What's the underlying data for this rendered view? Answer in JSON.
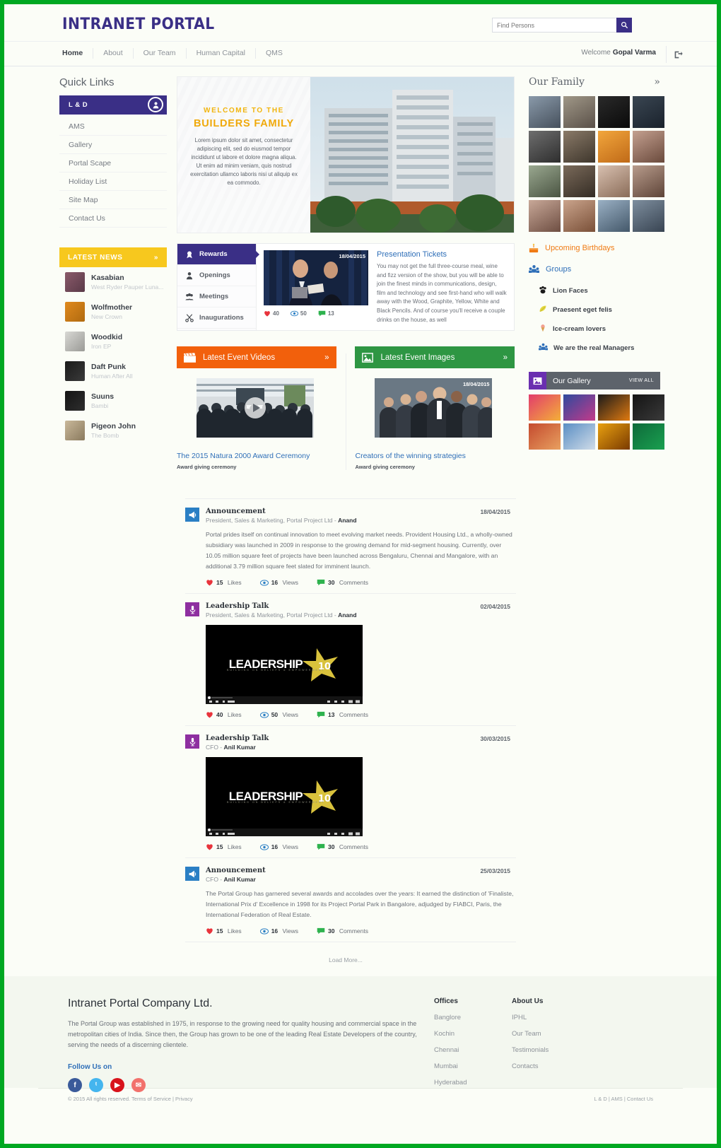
{
  "header": {
    "logo": "INTRANET PORTAL",
    "search_placeholder": "Find Persons",
    "welcome_label": "Welcome",
    "user_name": "Gopal Varma",
    "nav": [
      {
        "label": "Home"
      },
      {
        "label": "About"
      },
      {
        "label": "Our Team"
      },
      {
        "label": "Human Capital"
      },
      {
        "label": "QMS"
      }
    ]
  },
  "quick_links": {
    "title": "Quick Links",
    "active": "L & D",
    "items": [
      "AMS",
      "Gallery",
      "Portal Scape",
      "Holiday List",
      "Site Map",
      "Contact Us"
    ]
  },
  "latest_news": {
    "title": "LATEST NEWS",
    "more": "»",
    "items": [
      {
        "title": "Kasabian",
        "subtitle": "West Ryder Pauper Luna...",
        "color1": "#8a5a6a",
        "color2": "#5a3a48"
      },
      {
        "title": "Wolfmother",
        "subtitle": "New Crown",
        "color1": "#e08a1e",
        "color2": "#b06a10"
      },
      {
        "title": "Woodkid",
        "subtitle": "Iron EP",
        "color1": "#d8d8d4",
        "color2": "#9a9a96"
      },
      {
        "title": "Daft Punk",
        "subtitle": "Human After All",
        "color1": "#1a1a1a",
        "color2": "#3a3a3a"
      },
      {
        "title": "Suuns",
        "subtitle": "Bambi",
        "color1": "#141414",
        "color2": "#2e2e2e"
      },
      {
        "title": "Pigeon John",
        "subtitle": "The Bomb",
        "color1": "#c9b89a",
        "color2": "#8a7a5e"
      }
    ]
  },
  "banner": {
    "eyebrow": "WELCOME TO THE",
    "title": "BUILDERS FAMILY",
    "body": "Lorem ipsum dolor sit amet, consectetur adipiscing elit, sed do eiusmod tempor incididunt ut labore et dolore magna aliqua. Ut enim ad minim veniam, quis nostrud exercitation ullamco laboris nisi ut aliquip ex ea commodo."
  },
  "tabcard": {
    "tabs": [
      {
        "label": "Rewards",
        "icon": "award-icon",
        "active": true
      },
      {
        "label": "Openings",
        "icon": "person-icon",
        "active": false
      },
      {
        "label": "Meetings",
        "icon": "meeting-icon",
        "active": false
      },
      {
        "label": "Inaugurations",
        "icon": "scissors-icon",
        "active": false
      }
    ],
    "date": "18/04/2015",
    "stats": {
      "likes": "40",
      "views": "50",
      "comments": "13"
    },
    "heading": "Presentation Tickets",
    "body": "You may not get the full three-course meal, wine and fizz version of the show, but you will be able to join the finest minds in communications, design, film and technology and see first-hand who will walk away with the Wood, Graphite, Yellow, White and Black Pencils. And of course you'll receive a couple drinks on the house, as well"
  },
  "events": [
    {
      "title": "Latest Event Videos",
      "icon": "clapperboard-icon",
      "more": "»",
      "caption": "The 2015 Natura 2000 Award Ceremony",
      "subcaption": "Award giving ceremony",
      "has_play": true,
      "date": ""
    },
    {
      "title": "Latest Event Images",
      "icon": "image-icon",
      "more": "»",
      "caption": "Creators of the winning strategies",
      "subcaption": "Award giving ceremony",
      "has_play": false,
      "date": "18/04/2015"
    }
  ],
  "feed": {
    "posts": [
      {
        "type": "Announcement",
        "icon": "megaphone-icon",
        "icon_color": "blue",
        "author_prefix": "President, Sales & Marketing, Portal Project Ltd - ",
        "author": "Anand",
        "date": "18/04/2015",
        "body": "Portal prides itself on continual innovation to meet evolving market needs. Provident Housing Ltd., a wholly-owned subsidiary was launched in 2009 in response to the growing demand for mid-segment housing. Currently, over 10.05 million square feet of projects have been launched across Bengaluru, Chennai and Mangalore, with an additional 3.79 million square feet slated for imminent launch.",
        "video": false,
        "likes": "15",
        "views": "16",
        "comments": "30"
      },
      {
        "type": "Leadership Talk",
        "icon": "microphone-icon",
        "icon_color": "purple",
        "author_prefix": "President, Sales & Marketing, Portal Project Ltd - ",
        "author": "Anand",
        "date": "02/04/2015",
        "body": "",
        "video": true,
        "video_title": "LEADERSHIP",
        "video_year": "10",
        "video_tagline": "BUILDING ON BELIEFS & EMPOWERMENT",
        "likes": "40",
        "views": "50",
        "comments": "13"
      },
      {
        "type": "Leadership Talk",
        "icon": "microphone-icon",
        "icon_color": "purple",
        "author_prefix": "CFO - ",
        "author": "Anil Kumar",
        "date": "30/03/2015",
        "body": "",
        "video": true,
        "video_title": "LEADERSHIP",
        "video_year": "10",
        "video_tagline": "BUILDING ON BELIEFS & EMPOWERMENT",
        "likes": "15",
        "views": "16",
        "comments": "30"
      },
      {
        "type": "Announcement",
        "icon": "megaphone-icon",
        "icon_color": "blue",
        "author_prefix": "CFO - ",
        "author": "Anil Kumar",
        "date": "25/03/2015",
        "body": "The Portal Group has garnered several awards and accolades over the years: It earned the distinction of 'Finaliste, International Prix d' Excellence in 1998 for its Project Portal Park in Bangalore, adjudged by FIABCI, Paris, the International Federation of Real Estate.",
        "video": false,
        "likes": "15",
        "views": "16",
        "comments": "30"
      }
    ],
    "labels": {
      "likes": "Likes",
      "views": "Views",
      "comments": "Comments"
    },
    "load_more": "Load More..."
  },
  "right": {
    "family_title": "Our Family",
    "family_more": "»",
    "family_avatars": [
      {
        "c1": "#8a9aaa",
        "c2": "#46505c"
      },
      {
        "c1": "#a09888",
        "c2": "#5a5048"
      },
      {
        "c1": "#2a2a2a",
        "c2": "#0a0a0a"
      },
      {
        "c1": "#3a4652",
        "c2": "#1a222c"
      },
      {
        "c1": "#6e6e6e",
        "c2": "#2e2e2e"
      },
      {
        "c1": "#8a7a68",
        "c2": "#3e362c"
      },
      {
        "c1": "#f2a63c",
        "c2": "#c06a18"
      },
      {
        "c1": "#c4a090",
        "c2": "#6a4a3c"
      },
      {
        "c1": "#9aa890",
        "c2": "#4a5442"
      },
      {
        "c1": "#7a6a5a",
        "c2": "#342c24"
      },
      {
        "c1": "#d8c0b0",
        "c2": "#8a6c58"
      },
      {
        "c1": "#b89c8c",
        "c2": "#5e4438"
      },
      {
        "c1": "#c8a898",
        "c2": "#6e4e42"
      },
      {
        "c1": "#caa48c",
        "c2": "#7a5038"
      },
      {
        "c1": "#9ab0c4",
        "c2": "#44586a"
      },
      {
        "c1": "#7e8e9e",
        "c2": "#384452"
      }
    ],
    "birthdays_label": "Upcoming Birthdays",
    "birthdays_icon": "cake-icon",
    "groups_label": "Groups",
    "groups_icon": "group-icon",
    "groups": [
      {
        "label": "Lion Faces",
        "icon": "paw-icon"
      },
      {
        "label": "Praesent eget felis",
        "icon": "leaf-icon"
      },
      {
        "label": "Ice-cream lovers",
        "icon": "icecream-icon"
      },
      {
        "label": "We are the real Managers",
        "icon": "people-icon"
      }
    ],
    "gallery_title": "Our Gallery",
    "gallery_icon": "image-icon",
    "gallery_view_all": "VIEW ALL",
    "gallery_tiles": [
      {
        "c1": "#e23c6c",
        "c2": "#f4b038"
      },
      {
        "c1": "#2e4a9e",
        "c2": "#c43a8a"
      },
      {
        "c1": "#1a1a1a",
        "c2": "#e07a10"
      },
      {
        "c1": "#141414",
        "c2": "#3a3a3a"
      },
      {
        "c1": "#c44a2e",
        "c2": "#e8a060"
      },
      {
        "c1": "#5a8ec4",
        "c2": "#d0dce8"
      },
      {
        "c1": "#e8a010",
        "c2": "#7a3a00"
      },
      {
        "c1": "#0e6a3a",
        "c2": "#1aa050"
      }
    ]
  },
  "footer": {
    "company": "Intranet Portal Company Ltd.",
    "about": "The Portal Group was established in 1975, in response to the growing need for quality housing and commercial space in the metropolitan cities of India. Since then, the Group has grown to be one of the leading Real Estate Developers of the country, serving the needs of a discerning clientele.",
    "follow_label": "Follow Us on",
    "social": [
      {
        "name": "facebook-icon",
        "glyph": "f",
        "color": "#3a5a9a"
      },
      {
        "name": "twitter-icon",
        "glyph": "ᵗ",
        "color": "#44b5ee"
      },
      {
        "name": "youtube-icon",
        "glyph": "▶",
        "color": "#d8121a"
      },
      {
        "name": "email-icon",
        "glyph": "✉",
        "color": "#f2716c"
      }
    ],
    "columns": [
      {
        "title": "Offices",
        "links": [
          "Banglore",
          "Kochin",
          "Chennai",
          "Mumbai",
          "Hyderabad"
        ]
      },
      {
        "title": "About Us",
        "links": [
          "IPHL",
          "Our Team",
          "Testimonials",
          "Contacts"
        ]
      }
    ],
    "copyright": "© 2015 All rights reserved. Terms of Service | Privacy",
    "bottom_links": [
      "L & D",
      "AMS",
      "Contact Us"
    ]
  }
}
